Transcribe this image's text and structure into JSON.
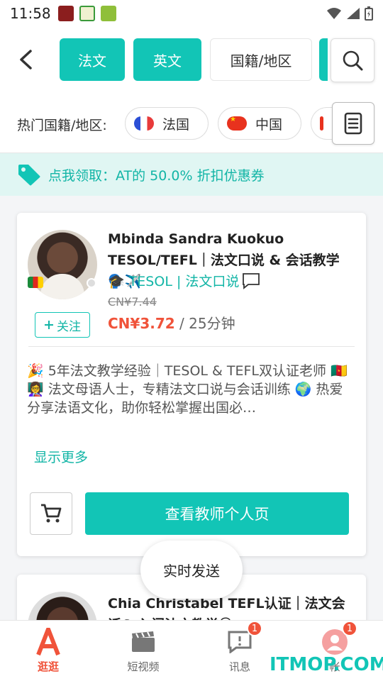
{
  "status_bar": {
    "time": "11:58"
  },
  "header": {
    "chips": [
      {
        "label": "法文",
        "active": true
      },
      {
        "label": "英文",
        "active": true
      },
      {
        "label": "国籍/地区",
        "active": false
      }
    ]
  },
  "country_filter": {
    "label": "热门国籍/地区:",
    "options": [
      {
        "label": "法国",
        "flag": "flag-fr"
      },
      {
        "label": "中国",
        "flag": "flag-cn"
      }
    ]
  },
  "coupon": {
    "text": "点我领取：AT的 50.0% 折扣优惠券"
  },
  "teacher_card": {
    "name": "Mbinda Sandra Kuokuo TESOL/TEFL｜法文口说 & 会话教学🗣️✈️",
    "tag": "🎓 TESOL | 法文口说",
    "old_price": "CN¥7.44",
    "price": "CN¥3.72",
    "duration": "/ 25分钟",
    "follow_label": "关注",
    "intro": "🎉 5年法文教学经验｜TESOL & TEFL双认证老师 🇨🇲 👩‍🏫 法文母语人士，专精法文口说与会话训练 🌍 热爱分享法语文化，助你轻松掌握出国必…",
    "show_more": "显示更多",
    "profile_button": "查看教师个人页"
  },
  "teacher_card_2": {
    "name": "Chia Christabel TEFL认证｜法文会话& 入门法文教学🗣"
  },
  "live_button": "实时发送",
  "bottom_nav": {
    "items": [
      {
        "label": "逛逛",
        "active": true
      },
      {
        "label": "短视频",
        "active": false
      },
      {
        "label": "讯息",
        "badge": "1"
      },
      {
        "label": "帐",
        "badge": "1"
      }
    ]
  },
  "watermark": "ITMOP.COM",
  "colors": {
    "accent": "#12c5b6",
    "price": "#f0533a"
  }
}
